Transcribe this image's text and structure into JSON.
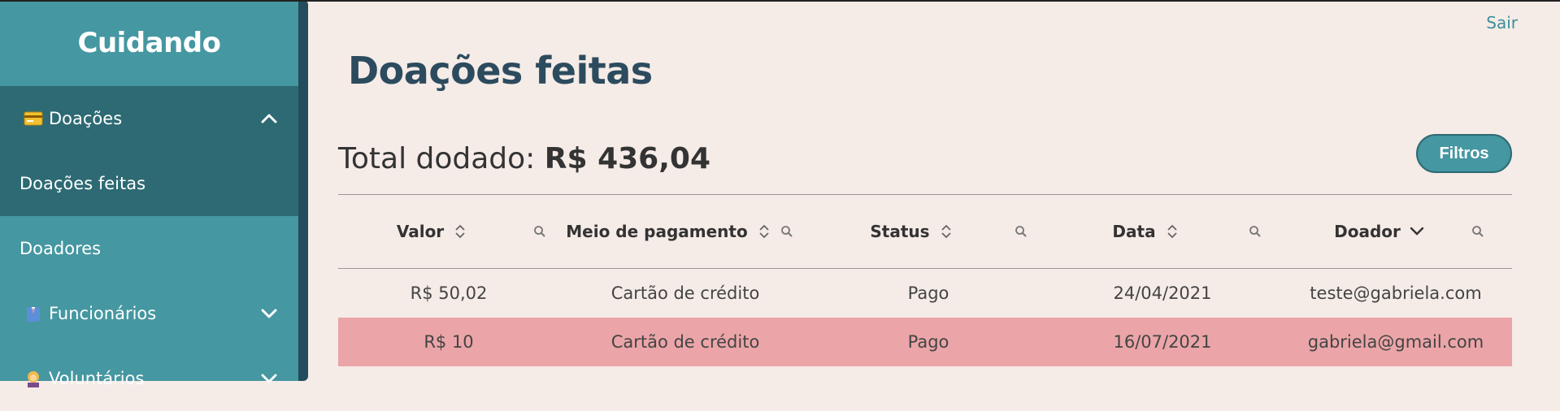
{
  "sidebar": {
    "brand": "Cuidando",
    "group_open": {
      "label": "Doações",
      "icon": "credit-card-icon",
      "expanded": true
    },
    "subitems": [
      {
        "label": "Doações feitas",
        "active": true
      }
    ],
    "items": [
      {
        "label": "Doadores"
      },
      {
        "label": "Funcionários",
        "icon": "employee-icon"
      },
      {
        "label": "Voluntários",
        "icon": "volunteer-icon"
      }
    ]
  },
  "header": {
    "logout_label": "Sair"
  },
  "main": {
    "title": "Doações feitas",
    "total_label": "Total dodado:",
    "total_value": "R$ 436,04",
    "filter_label": "Filtros"
  },
  "table": {
    "columns": [
      "Valor",
      "Meio de pagamento",
      "Status",
      "Data",
      "Doador"
    ],
    "rows": [
      {
        "valor": "R$ 50,02",
        "meio": "Cartão de crédito",
        "status": "Pago",
        "data": "24/04/2021",
        "doador": "teste@gabriela.com",
        "highlight": false
      },
      {
        "valor": "R$ 10",
        "meio": "Cartão de crédito",
        "status": "Pago",
        "data": "16/07/2021",
        "doador": "gabriela@gmail.com",
        "highlight": true
      }
    ]
  },
  "colors": {
    "sidebar": "#4597a1",
    "sidebar_active": "#2d6a73",
    "page_bg": "#f5ebe7",
    "title": "#2c4b5e",
    "row_highlight": "#eba5a8"
  }
}
